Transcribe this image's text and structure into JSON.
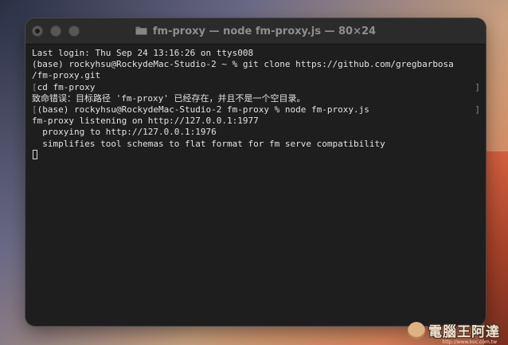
{
  "window": {
    "title": "fm-proxy — node fm-proxy.js — 80×24"
  },
  "terminal": {
    "lines": [
      "Last login: Thu Sep 24 13:16:26 on ttys008",
      "(base) rockyhsu@RockydeMac-Studio-2 ~ % git clone https://github.com/gregbarbosa",
      "/fm-proxy.git",
      "cd fm-proxy",
      "致命错误：目标路径 'fm-proxy' 已经存在，并且不是一个空目录。",
      "(base) rockyhsu@RockydeMac-Studio-2 fm-proxy % node fm-proxy.js",
      "fm-proxy listening on http://127.0.0.1:1977",
      "  proxying to http://127.0.0.1:1976",
      "  simplifies tool schemas to flat format for fm serve compatibility"
    ],
    "marks": {
      "left": "[",
      "right": "]"
    }
  },
  "watermark": {
    "text": "電腦王阿達",
    "url": "http://www.koc.com.tw"
  }
}
